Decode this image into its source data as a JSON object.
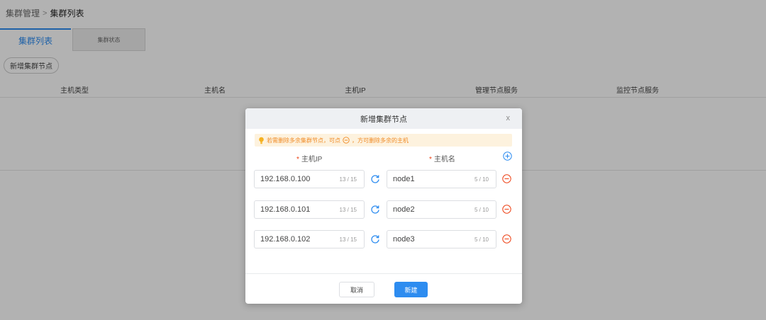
{
  "breadcrumb": {
    "parent": "集群管理",
    "separator": ">",
    "current": "集群列表"
  },
  "tabs": [
    {
      "label": "集群列表",
      "active": true
    },
    {
      "label": "集群状态",
      "active": false
    }
  ],
  "toolbar": {
    "add_node_label": "新增集群节点"
  },
  "table": {
    "headers": [
      "主机类型",
      "主机名",
      "主机IP",
      "管理节点服务",
      "监控节点服务"
    ]
  },
  "modal": {
    "title": "新增集群节点",
    "close_label": "x",
    "tip": {
      "before": "若需删除多余集群节点，可点",
      "after": "，方可删除多余的主机"
    },
    "ip_label": "主机IP",
    "name_label": "主机名",
    "required_mark": "*",
    "rows": [
      {
        "ip": "192.168.0.100",
        "ip_count": "13 / 15",
        "name": "node1",
        "name_count": "5 / 10"
      },
      {
        "ip": "192.168.0.101",
        "ip_count": "13 / 15",
        "name": "node2",
        "name_count": "5 / 10"
      },
      {
        "ip": "192.168.0.102",
        "ip_count": "13 / 15",
        "name": "node3",
        "name_count": "5 / 10"
      }
    ],
    "cancel_label": "取消",
    "create_label": "新建"
  },
  "colors": {
    "primary": "#2d8cf0",
    "danger": "#ed4014",
    "warning": "#f08a24",
    "tip_bg": "#fdf2de"
  },
  "icons": {
    "refresh": "refresh-icon",
    "remove": "minus-circle-icon",
    "add": "plus-circle-icon",
    "tip": "lightbulb-icon"
  }
}
